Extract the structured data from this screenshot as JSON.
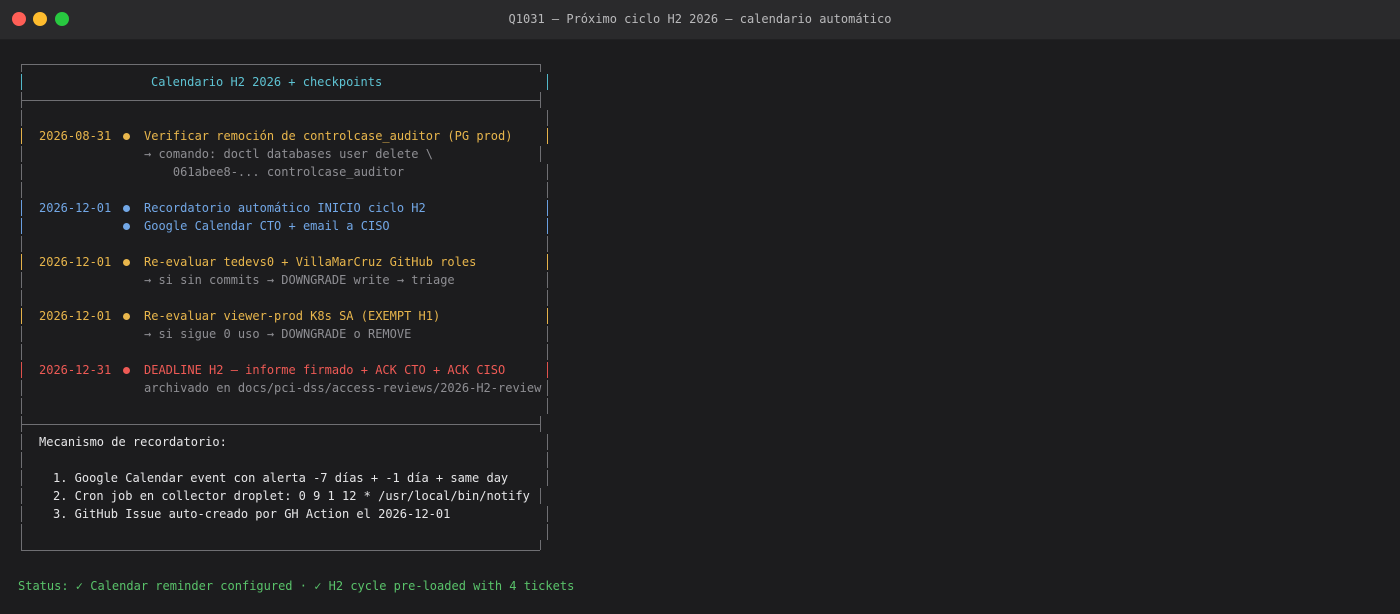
{
  "window": {
    "title": "Q1031 — Próximo ciclo H2 2026 — calendario automático"
  },
  "panel": {
    "header": "Calendario H2 2026 + checkpoints",
    "entries": [
      {
        "date": "2026-08-31",
        "color": "#e8b64c",
        "title": "Verificar remoción de controlcase_auditor (PG prod)",
        "notes": [
          "→ comando: doctl databases user delete \\",
          "    061abee8-... controlcase_auditor"
        ]
      },
      {
        "date": "2026-12-01",
        "color": "#72a7e6",
        "title": "Recordatorio automático INICIO ciclo H2",
        "second_title": "Google Calendar CTO + email a CISO"
      },
      {
        "date": "2026-12-01",
        "color": "#e8b64c",
        "title": "Re-evaluar tedevs0 + VillaMarCruz GitHub roles",
        "notes": [
          "→ si sin commits → DOWNGRADE write → triage"
        ]
      },
      {
        "date": "2026-12-01",
        "color": "#e8b64c",
        "title": "Re-evaluar viewer-prod K8s SA (EXEMPT H1)",
        "notes": [
          "→ si sigue 0 uso → DOWNGRADE o REMOVE"
        ]
      },
      {
        "date": "2026-12-31",
        "color": "#ee5a55",
        "title": "DEADLINE H2 — informe firmado + ACK CTO + ACK CISO",
        "notes": [
          "archivado en docs/pci-dss/access-reviews/2026-H2-review"
        ]
      }
    ],
    "mechanism": {
      "heading": "Mecanismo de recordatorio:",
      "items": [
        "1. Google Calendar event con alerta -7 días + -1 día + same day",
        "2. Cron job en collector droplet: 0 9 1 12 * /usr/local/bin/notify",
        "3. GitHub Issue auto-creado por GH Action el 2026-12-01"
      ]
    }
  },
  "status": {
    "text": "Status: ✓ Calendar reminder configured · ✓ H2 cycle pre-loaded with 4 tickets"
  }
}
